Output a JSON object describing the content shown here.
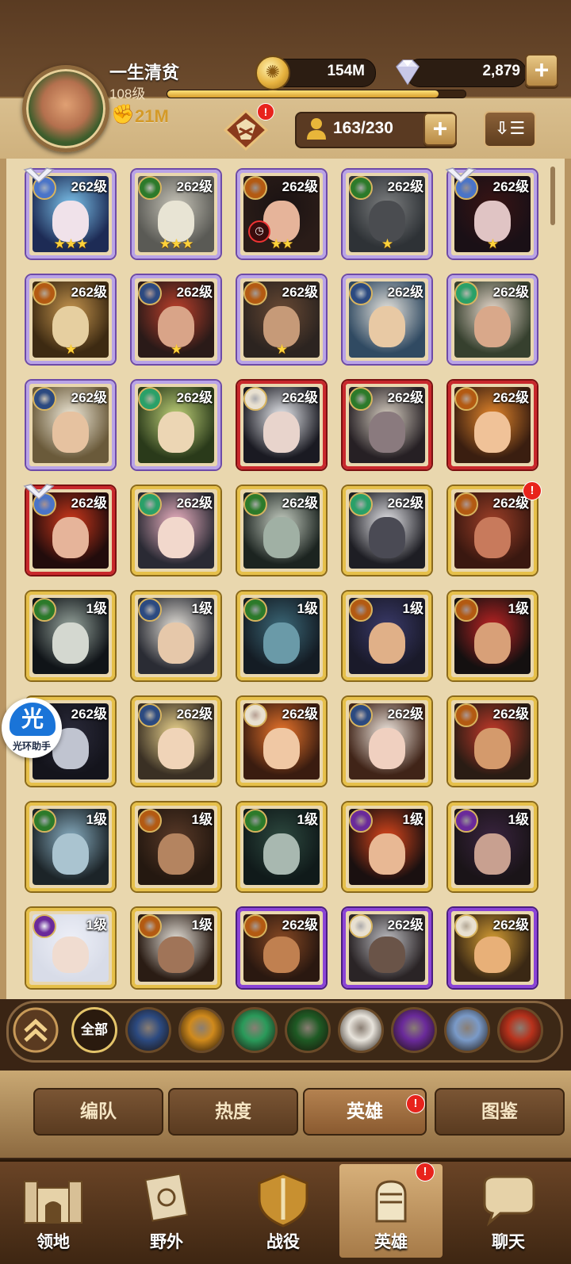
{
  "player": {
    "name": "一生清贫",
    "level": "108级",
    "power": "21M",
    "xp_fraction": 0.91
  },
  "resources": {
    "gold": "154M",
    "gems": "2,879"
  },
  "heroes": {
    "count": "163/230"
  },
  "icons": {
    "gold": "gold-coin-icon",
    "gem": "diamond-icon",
    "power": "fist-icon",
    "hero_count": "person-icon",
    "sort": "sort-icon"
  },
  "grid": [
    {
      "level": "262级",
      "frame": "purple",
      "faction": "celestial",
      "stars": "★★★",
      "palette": [
        "#1d2b55",
        "#7fc7ef",
        "#f0e2ea"
      ],
      "wing": true
    },
    {
      "level": "262级",
      "frame": "purple",
      "faction": "wilder",
      "stars": "★★★",
      "palette": [
        "#5a5a55",
        "#c9c6ba",
        "#e8e4d4"
      ]
    },
    {
      "level": "262级",
      "frame": "purple",
      "faction": "mauler",
      "stars": "★★",
      "palette": [
        "#2a1c18",
        "#1a1212",
        "#e6b49a"
      ],
      "timer": true
    },
    {
      "level": "262级",
      "frame": "purple",
      "faction": "wilder",
      "stars": "★",
      "palette": [
        "#2e3236",
        "#7d7f80",
        "#4a4c50"
      ]
    },
    {
      "level": "262级",
      "frame": "purple",
      "faction": "celestial",
      "stars": "★",
      "palette": [
        "#1a1016",
        "#3a1414",
        "#e0c4c4"
      ],
      "wing": true
    },
    {
      "level": "262级",
      "frame": "purple",
      "faction": "mauler",
      "stars": "★",
      "palette": [
        "#3d2a12",
        "#c99850",
        "#e6cfa0"
      ]
    },
    {
      "level": "262级",
      "frame": "purple",
      "faction": "lightbearer",
      "stars": "★",
      "palette": [
        "#2a1a18",
        "#c2412c",
        "#d9a488"
      ]
    },
    {
      "level": "262级",
      "frame": "purple",
      "faction": "mauler",
      "stars": "★",
      "palette": [
        "#2c2420",
        "#6a4a34",
        "#c69a78"
      ]
    },
    {
      "level": "262级",
      "frame": "purple",
      "faction": "lightbearer",
      "stars": "",
      "palette": [
        "#304a62",
        "#ece8e0",
        "#e8c9a4"
      ]
    },
    {
      "level": "262级",
      "frame": "purple",
      "faction": "graveborn",
      "stars": "",
      "palette": [
        "#36402e",
        "#ecdcd0",
        "#d9a88a"
      ]
    },
    {
      "level": "262级",
      "frame": "purple",
      "faction": "lightbearer",
      "stars": "",
      "palette": [
        "#6a5a3a",
        "#f2ecdc",
        "#e6c2a0"
      ]
    },
    {
      "level": "262级",
      "frame": "purple",
      "faction": "graveborn",
      "stars": "",
      "palette": [
        "#2a3a1a",
        "#c2d47a",
        "#ecd6b4"
      ]
    },
    {
      "level": "262级",
      "frame": "red",
      "faction": "hypogean",
      "stars": "",
      "palette": [
        "#1a1a22",
        "#eef0f4",
        "#e8d4cc"
      ]
    },
    {
      "level": "262级",
      "frame": "red",
      "faction": "wilder",
      "stars": "",
      "palette": [
        "#262024",
        "#d8cfc2",
        "#8a7a7e"
      ]
    },
    {
      "level": "262级",
      "frame": "red",
      "faction": "mauler",
      "stars": "",
      "palette": [
        "#3a1e10",
        "#e8892c",
        "#f0c298"
      ]
    },
    {
      "level": "262级",
      "frame": "red",
      "faction": "celestial",
      "stars": "",
      "palette": [
        "#220c0c",
        "#d43a1c",
        "#e6b49a"
      ],
      "wing": true
    },
    {
      "level": "262级",
      "frame": "gold",
      "faction": "graveborn",
      "stars": "",
      "palette": [
        "#2a2a34",
        "#f0b4c4",
        "#f2d8cc"
      ]
    },
    {
      "level": "262级",
      "frame": "gold",
      "faction": "wilder",
      "stars": "",
      "palette": [
        "#1c2420",
        "#c8d0c4",
        "#a0b0a4"
      ]
    },
    {
      "level": "262级",
      "frame": "gold",
      "faction": "graveborn",
      "stars": "",
      "palette": [
        "#1e1e24",
        "#e8e8ec",
        "#4a4a54"
      ]
    },
    {
      "level": "262级",
      "frame": "gold",
      "faction": "mauler",
      "stars": "",
      "palette": [
        "#3a1810",
        "#a04028",
        "#c87a5c"
      ],
      "badge": true
    },
    {
      "level": "1级",
      "frame": "gold",
      "faction": "wilder",
      "stars": "",
      "palette": [
        "#101418",
        "#9aa8a0",
        "#d4d8d0"
      ]
    },
    {
      "level": "1级",
      "frame": "gold",
      "faction": "lightbearer",
      "stars": "",
      "palette": [
        "#2a2c34",
        "#e8e4dc",
        "#e6c8aa"
      ]
    },
    {
      "level": "1级",
      "frame": "gold",
      "faction": "wilder",
      "stars": "",
      "palette": [
        "#141c24",
        "#3c6a7a",
        "#6a9aa8"
      ]
    },
    {
      "level": "1级",
      "frame": "gold",
      "faction": "mauler",
      "stars": "",
      "palette": [
        "#1a1a2a",
        "#3a3a6a",
        "#e0b088"
      ]
    },
    {
      "level": "1级",
      "frame": "gold",
      "faction": "mauler",
      "stars": "",
      "palette": [
        "#141010",
        "#c22424",
        "#d8a078"
      ]
    },
    {
      "level": "262级",
      "frame": "gold",
      "faction": "lightbearer",
      "stars": "",
      "palette": [
        "#14141c",
        "#2a2a3a",
        "#c0c4d0"
      ]
    },
    {
      "level": "262级",
      "frame": "gold",
      "faction": "lightbearer",
      "stars": "",
      "palette": [
        "#3a3024",
        "#f0d890",
        "#f0d4b8"
      ]
    },
    {
      "level": "262级",
      "frame": "gold",
      "faction": "hypogean",
      "stars": "",
      "palette": [
        "#3a1c10",
        "#f0782c",
        "#f0c8a4"
      ]
    },
    {
      "level": "262级",
      "frame": "gold",
      "faction": "lightbearer",
      "stars": "",
      "palette": [
        "#402418",
        "#f4ece4",
        "#f0d0c0"
      ]
    },
    {
      "level": "262级",
      "frame": "gold",
      "faction": "mauler",
      "stars": "",
      "palette": [
        "#2a1c14",
        "#c83a2a",
        "#d49a6c"
      ]
    },
    {
      "level": "1级",
      "frame": "gold",
      "faction": "wilder",
      "stars": "",
      "palette": [
        "#1c2428",
        "#8ab0c4",
        "#aac4d0"
      ]
    },
    {
      "level": "1级",
      "frame": "gold",
      "faction": "mauler",
      "stars": "",
      "palette": [
        "#241810",
        "#5a3a28",
        "#b48460"
      ]
    },
    {
      "level": "1级",
      "frame": "gold",
      "faction": "wilder",
      "stars": "",
      "palette": [
        "#101a1a",
        "#2e4a40",
        "#a8b8b0"
      ]
    },
    {
      "level": "1级",
      "frame": "gold",
      "faction": "dimensional",
      "stars": "",
      "palette": [
        "#1a1010",
        "#e0481c",
        "#e8b894"
      ]
    },
    {
      "level": "1级",
      "frame": "gold",
      "faction": "dimensional",
      "stars": "",
      "palette": [
        "#1a1418",
        "#3a2440",
        "#c8a090"
      ]
    },
    {
      "level": "1级",
      "frame": "gold",
      "faction": "dimensional",
      "stars": "",
      "palette": [
        "#d8dce8",
        "#eef0f8",
        "#f0dcd0"
      ]
    },
    {
      "level": "1级",
      "frame": "gold",
      "faction": "mauler",
      "stars": "",
      "palette": [
        "#2a1c14",
        "#e8e4dc",
        "#a07458"
      ]
    },
    {
      "level": "262级",
      "frame": "violet",
      "faction": "mauler",
      "stars": "",
      "palette": [
        "#2a1810",
        "#8a4a24",
        "#c08050"
      ]
    },
    {
      "level": "262级",
      "frame": "violet",
      "faction": "hypogean",
      "stars": "",
      "palette": [
        "#2a2426",
        "#c0c0c4",
        "#6a5448"
      ]
    },
    {
      "level": "262级",
      "frame": "violet",
      "faction": "hypogean",
      "stars": "",
      "palette": [
        "#3a2814",
        "#d8a034",
        "#e8b078"
      ]
    }
  ],
  "faction_colors": {
    "lightbearer": "#2c4a80",
    "mauler": "#b35a12",
    "wilder": "#2c7a2a",
    "graveborn": "#2aa068",
    "celestial": "#4a74c8",
    "hypogean": "#e8e0d0",
    "dimensional": "#6a2a9a"
  },
  "filters": {
    "collapse_icon": "double-chevron-up-icon",
    "all_label": "全部",
    "items": [
      {
        "name": "lightbearer",
        "color": "#2c4a80"
      },
      {
        "name": "mauler",
        "color": "#d08a1c"
      },
      {
        "name": "wilder",
        "color": "#2a9a5a"
      },
      {
        "name": "graveborn",
        "color": "#1e5a24"
      },
      {
        "name": "celestial",
        "color": "#e8e4dc"
      },
      {
        "name": "hypogean",
        "color": "#6a2a9a"
      },
      {
        "name": "dimensional",
        "color": "#7a9ac8"
      },
      {
        "name": "draconis",
        "color": "#b8321c"
      }
    ]
  },
  "subtabs": [
    "编队",
    "热度",
    "英雄",
    "图鉴"
  ],
  "bottom_nav": [
    "领地",
    "野外",
    "战役",
    "英雄",
    "聊天"
  ],
  "badge_text": "!",
  "helper": {
    "char": "光",
    "label": "光环助手"
  },
  "timer_glyph": "◷"
}
